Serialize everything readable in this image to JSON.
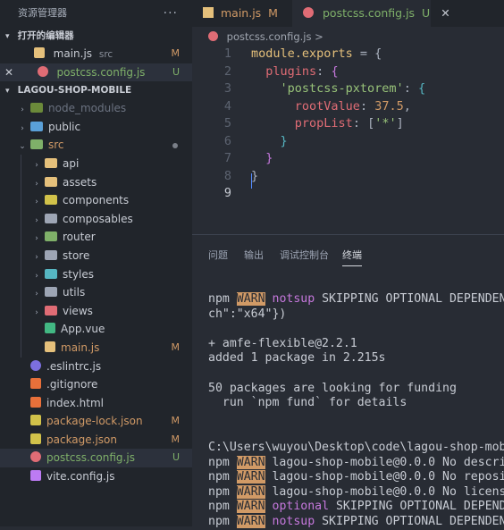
{
  "explorer": {
    "title": "资源管理器",
    "more": "···",
    "open_editors_title": "打开的编辑器",
    "open_editors": [
      {
        "name": "main.js",
        "hint": "src",
        "status": "M",
        "icon": "js-file-icon",
        "selected": false
      },
      {
        "name": "postcss.config.js",
        "hint": "",
        "status": "U",
        "icon": "postcss-file-icon",
        "selected": true
      }
    ],
    "project_title": "LAGOU-SHOP-MOBILE",
    "tree": [
      {
        "name": "node_modules",
        "type": "folder",
        "depth": 1,
        "collapsed": true,
        "dim": true,
        "status": ""
      },
      {
        "name": "public",
        "type": "folder",
        "depth": 1,
        "collapsed": true,
        "status": ""
      },
      {
        "name": "src",
        "type": "folder",
        "depth": 1,
        "collapsed": false,
        "status": "dot"
      },
      {
        "name": "api",
        "type": "folder",
        "depth": 2,
        "collapsed": true,
        "status": ""
      },
      {
        "name": "assets",
        "type": "folder",
        "depth": 2,
        "collapsed": true,
        "status": ""
      },
      {
        "name": "components",
        "type": "folder",
        "depth": 2,
        "collapsed": true,
        "status": ""
      },
      {
        "name": "composables",
        "type": "folder",
        "depth": 2,
        "collapsed": true,
        "status": ""
      },
      {
        "name": "router",
        "type": "folder",
        "depth": 2,
        "collapsed": true,
        "status": ""
      },
      {
        "name": "store",
        "type": "folder",
        "depth": 2,
        "collapsed": true,
        "status": ""
      },
      {
        "name": "styles",
        "type": "folder",
        "depth": 2,
        "collapsed": true,
        "status": ""
      },
      {
        "name": "utils",
        "type": "folder",
        "depth": 2,
        "collapsed": true,
        "status": ""
      },
      {
        "name": "views",
        "type": "folder",
        "depth": 2,
        "collapsed": true,
        "status": ""
      },
      {
        "name": "App.vue",
        "type": "vue",
        "depth": 2,
        "status": ""
      },
      {
        "name": "main.js",
        "type": "js",
        "depth": 2,
        "status": "M"
      },
      {
        "name": ".eslintrc.js",
        "type": "eslint",
        "depth": 1,
        "status": ""
      },
      {
        "name": ".gitignore",
        "type": "git",
        "depth": 1,
        "status": ""
      },
      {
        "name": "index.html",
        "type": "html",
        "depth": 1,
        "status": ""
      },
      {
        "name": "package-lock.json",
        "type": "json",
        "depth": 1,
        "status": "M"
      },
      {
        "name": "package.json",
        "type": "json",
        "depth": 1,
        "status": "M"
      },
      {
        "name": "postcss.config.js",
        "type": "postcss",
        "depth": 1,
        "status": "U",
        "selected": true
      },
      {
        "name": "vite.config.js",
        "type": "vite",
        "depth": 1,
        "status": ""
      }
    ]
  },
  "tabs": [
    {
      "name": "main.js",
      "status": "M",
      "active": false
    },
    {
      "name": "postcss.config.js",
      "status": "U",
      "active": true
    }
  ],
  "breadcrumb": "postcss.config.js >",
  "editor_lines": [
    "1",
    "2",
    "3",
    "4",
    "5",
    "6",
    "7",
    "8",
    "9"
  ],
  "panel_tabs": [
    "问题",
    "输出",
    "调试控制台",
    "终端"
  ],
  "terminal": {
    "npm": "npm",
    "warn": "WARN",
    "notsup": "notsup",
    "optional": "optional",
    "l1_rest": " SKIPPING OPTIONAL DEPENDEN",
    "l2": "ch\":\"x64\"})",
    "l3": "+ amfe-flexible@2.2.1",
    "l4": "added 1 package in 2.215s",
    "l5": "50 packages are looking for funding",
    "l6": "  run `npm fund` for details",
    "l7": "C:\\Users\\wuyou\\Desktop\\code\\lagou-shop-mob",
    "l8_rest": " lagou-shop-mobile@0.0.0 No descri",
    "l9_rest": " lagou-shop-mobile@0.0.0 No reposi",
    "l10_rest": " lagou-shop-mobile@0.0.0 No licens",
    "l11_rest": " SKIPPING OPTIONAL DEPEND",
    "l12_rest": " SKIPPING OPTIONAL DEPENDEN"
  },
  "code": {
    "module_exports": "module.exports",
    "eq": " = {",
    "plugins": "plugins",
    "plugin_name": "'postcss-pxtorem'",
    "rootValue": "rootValue",
    "root_num": "37.5",
    "propList": "propList",
    "prop_val": "'*'"
  },
  "colors": {
    "accent_M": "#d19a66",
    "accent_U": "#7fb069",
    "warn_bg": "#d19a66"
  }
}
